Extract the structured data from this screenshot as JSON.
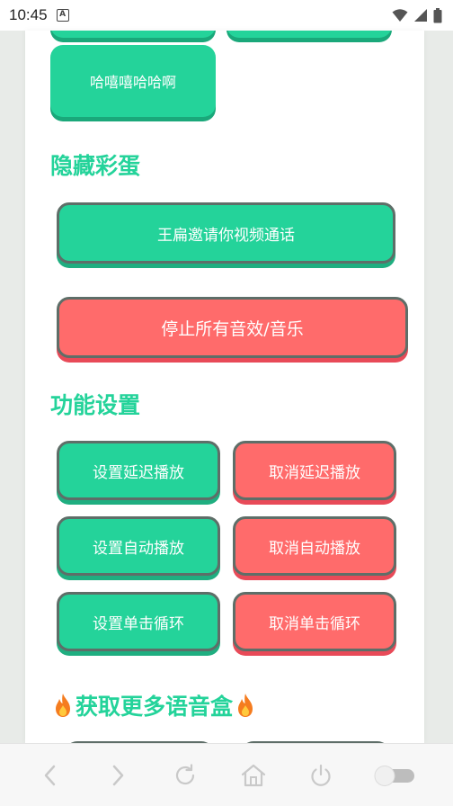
{
  "status_bar": {
    "time": "10:45",
    "notification_glyph": "A",
    "icons": [
      "wifi-icon",
      "signal-icon",
      "battery-icon"
    ]
  },
  "top_buttons": {
    "partial_left": "",
    "partial_right": "",
    "hahaha": "哈嘻嘻哈哈啊"
  },
  "hidden_egg": {
    "title": "隐藏彩蛋",
    "video_call": "王扁邀请你视频通话",
    "stop_all": "停止所有音效/音乐"
  },
  "settings": {
    "title": "功能设置",
    "rows": [
      {
        "set": "设置延迟播放",
        "cancel": "取消延迟播放"
      },
      {
        "set": "设置自动播放",
        "cancel": "取消自动播放"
      },
      {
        "set": "设置单击循环",
        "cancel": "取消单击循环"
      }
    ]
  },
  "more": {
    "title": "获取更多语音盒",
    "icon": "flame-icon"
  },
  "bottom_nav": {
    "items": [
      "back-icon",
      "forward-icon",
      "refresh-icon",
      "home-icon",
      "power-icon",
      "toggle-switch"
    ]
  },
  "colors": {
    "green": "#24d39a",
    "red": "#ff6b6b",
    "title_green": "#24d39a"
  }
}
